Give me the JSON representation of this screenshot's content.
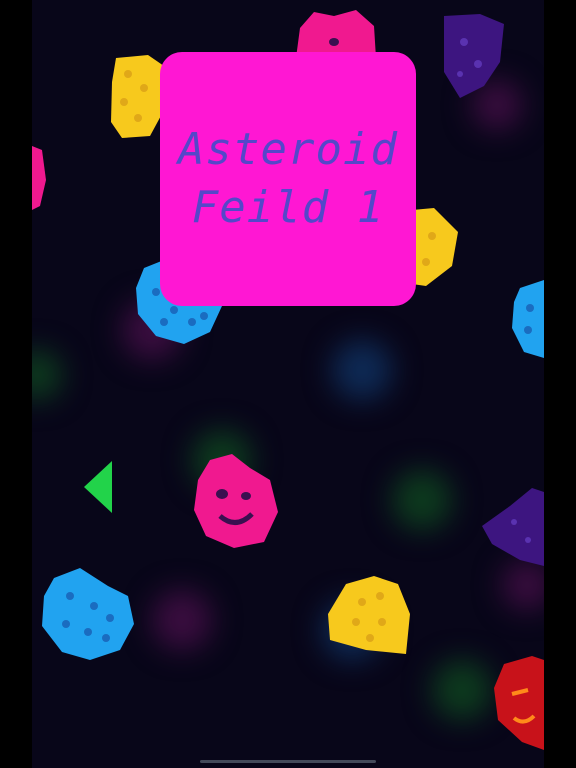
{
  "title": {
    "line1": "Asteroid",
    "line2": "Feild 1"
  },
  "colors": {
    "background": "#080619",
    "card": "#ff17d3",
    "title_text": "#5547c9",
    "back_arrow": "#22d34a",
    "asteroid_yellow": "#f7c91d",
    "asteroid_blue": "#21a3f0",
    "asteroid_pink": "#f0198f",
    "asteroid_purple": "#3d1580",
    "asteroid_red": "#c8121a"
  },
  "icons": {
    "back": "left-triangle-icon"
  }
}
